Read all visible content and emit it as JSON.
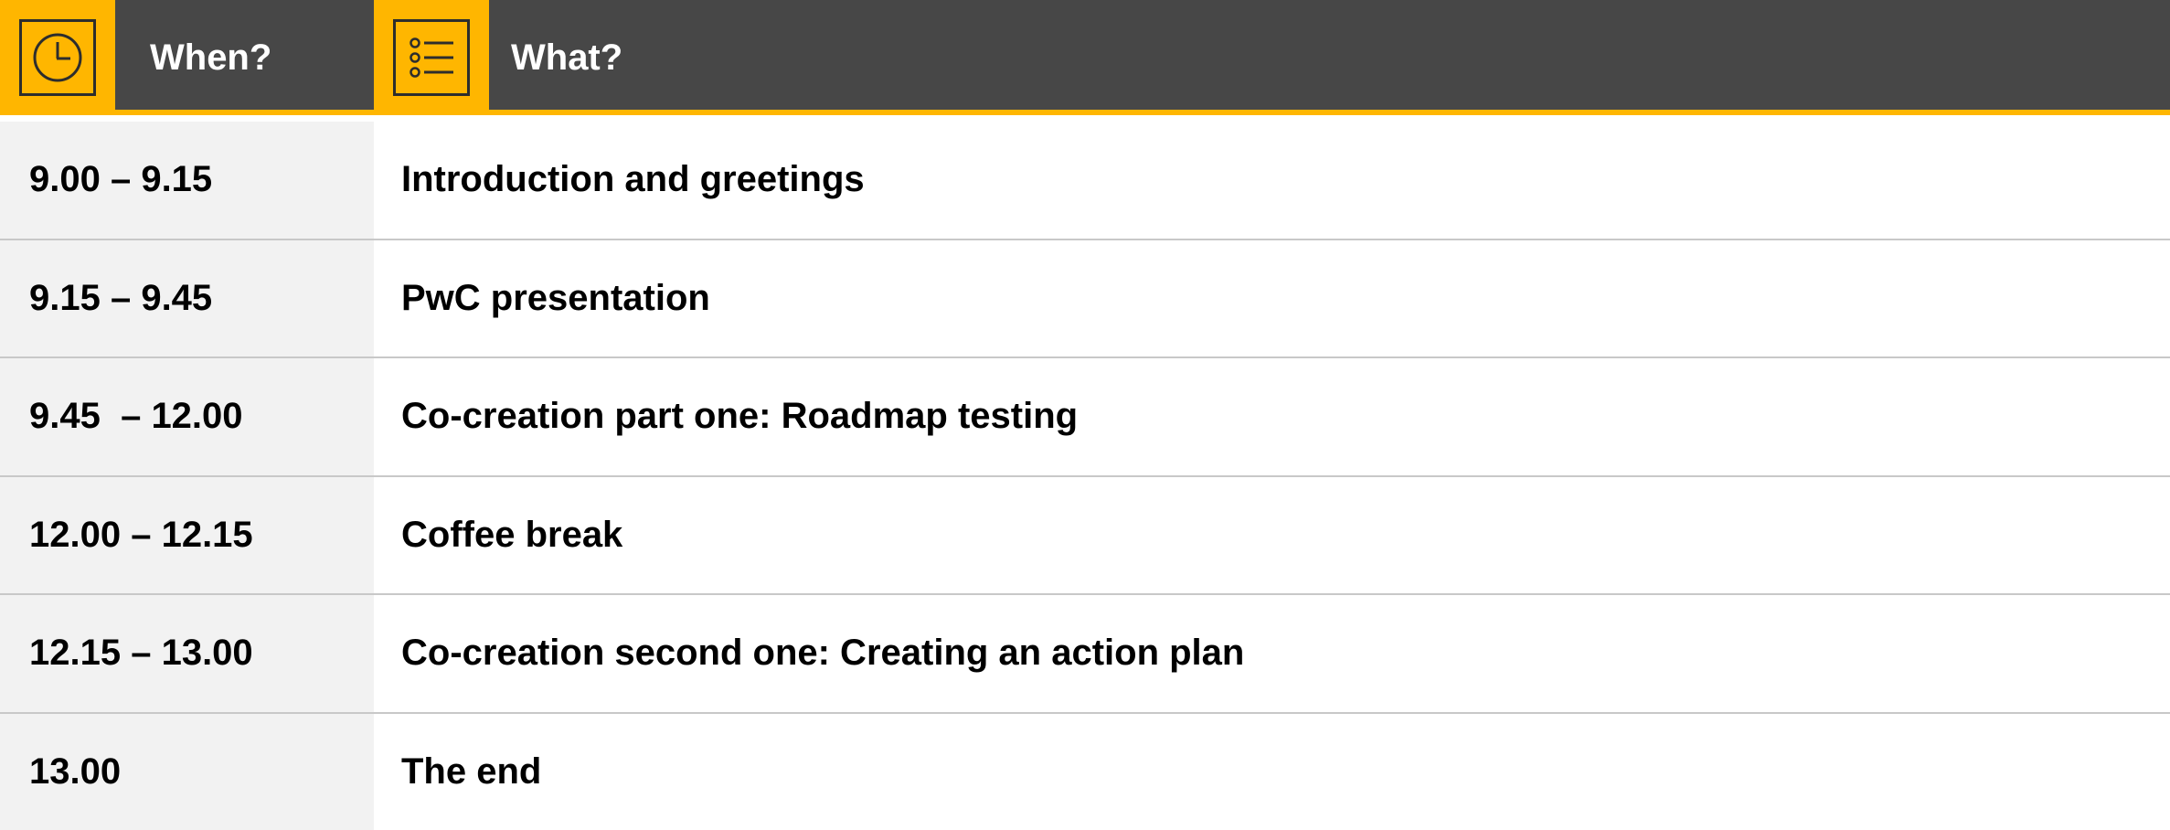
{
  "colors": {
    "accent": "#ffb600",
    "header_bg": "#474747",
    "when_column_bg": "#f2f2f2",
    "divider": "#c8c8c8"
  },
  "header": {
    "when_icon": "clock-icon",
    "when_label": "When?",
    "what_icon": "list-icon",
    "what_label": "What?"
  },
  "rows": [
    {
      "when": "9.00 – 9.15",
      "what": "Introduction and greetings"
    },
    {
      "when": "9.15 – 9.45",
      "what": "PwC presentation"
    },
    {
      "when": "9.45  – 12.00",
      "what": "Co-creation part one: Roadmap testing"
    },
    {
      "when": "12.00 – 12.15",
      "what": "Coffee break"
    },
    {
      "when": "12.15 – 13.00",
      "what": "Co-creation second one: Creating an action plan"
    },
    {
      "when": "13.00",
      "what": "The end"
    }
  ]
}
